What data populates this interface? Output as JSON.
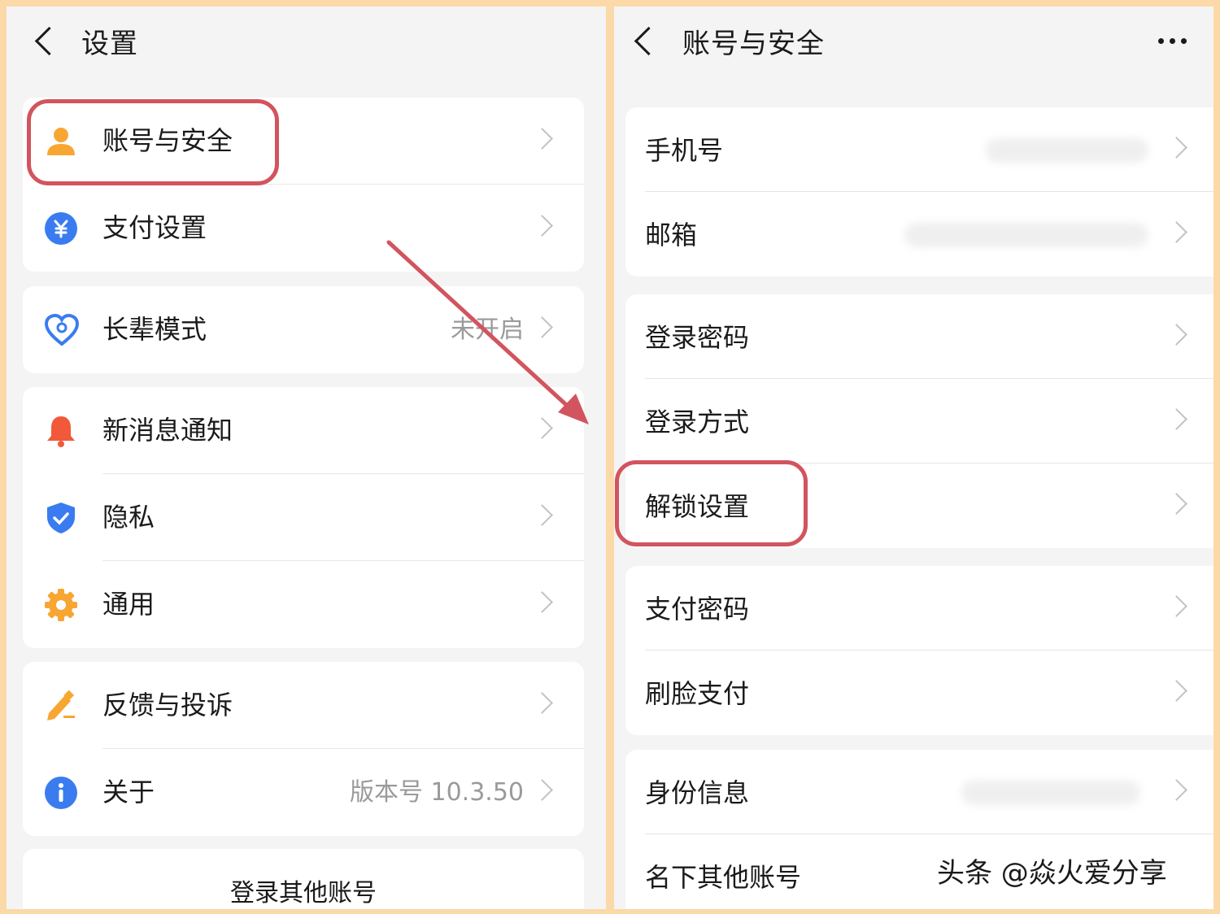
{
  "left": {
    "title": "设置",
    "groups": [
      {
        "items": [
          {
            "label": "账号与安全",
            "icon": "person-icon",
            "value": ""
          },
          {
            "label": "支付设置",
            "icon": "yuan-icon",
            "value": ""
          }
        ]
      },
      {
        "items": [
          {
            "label": "长辈模式",
            "icon": "heart-icon",
            "value": "未开启"
          }
        ]
      },
      {
        "items": [
          {
            "label": "新消息通知",
            "icon": "bell-icon",
            "value": ""
          },
          {
            "label": "隐私",
            "icon": "shield-icon",
            "value": ""
          },
          {
            "label": "通用",
            "icon": "gear-icon",
            "value": ""
          }
        ]
      },
      {
        "items": [
          {
            "label": "反馈与投诉",
            "icon": "pencil-icon",
            "value": ""
          },
          {
            "label": "关于",
            "icon": "info-icon",
            "value": "版本号 10.3.50"
          }
        ]
      }
    ],
    "footer_button": "登录其他账号"
  },
  "right": {
    "title": "账号与安全",
    "groups": [
      {
        "items": [
          {
            "label": "手机号"
          },
          {
            "label": "邮箱"
          }
        ]
      },
      {
        "items": [
          {
            "label": "登录密码"
          },
          {
            "label": "登录方式"
          },
          {
            "label": "解锁设置"
          }
        ]
      },
      {
        "items": [
          {
            "label": "支付密码"
          },
          {
            "label": "刷脸支付"
          }
        ]
      },
      {
        "items": [
          {
            "label": "身份信息"
          },
          {
            "label": "名下其他账号"
          }
        ]
      }
    ]
  },
  "watermark": "头条 @焱火爱分享",
  "colors": {
    "frame": "#fbd9a8",
    "highlight": "#d2545e",
    "blue": "#3a7cf0",
    "orange": "#f8a632",
    "red": "#f2593b"
  }
}
